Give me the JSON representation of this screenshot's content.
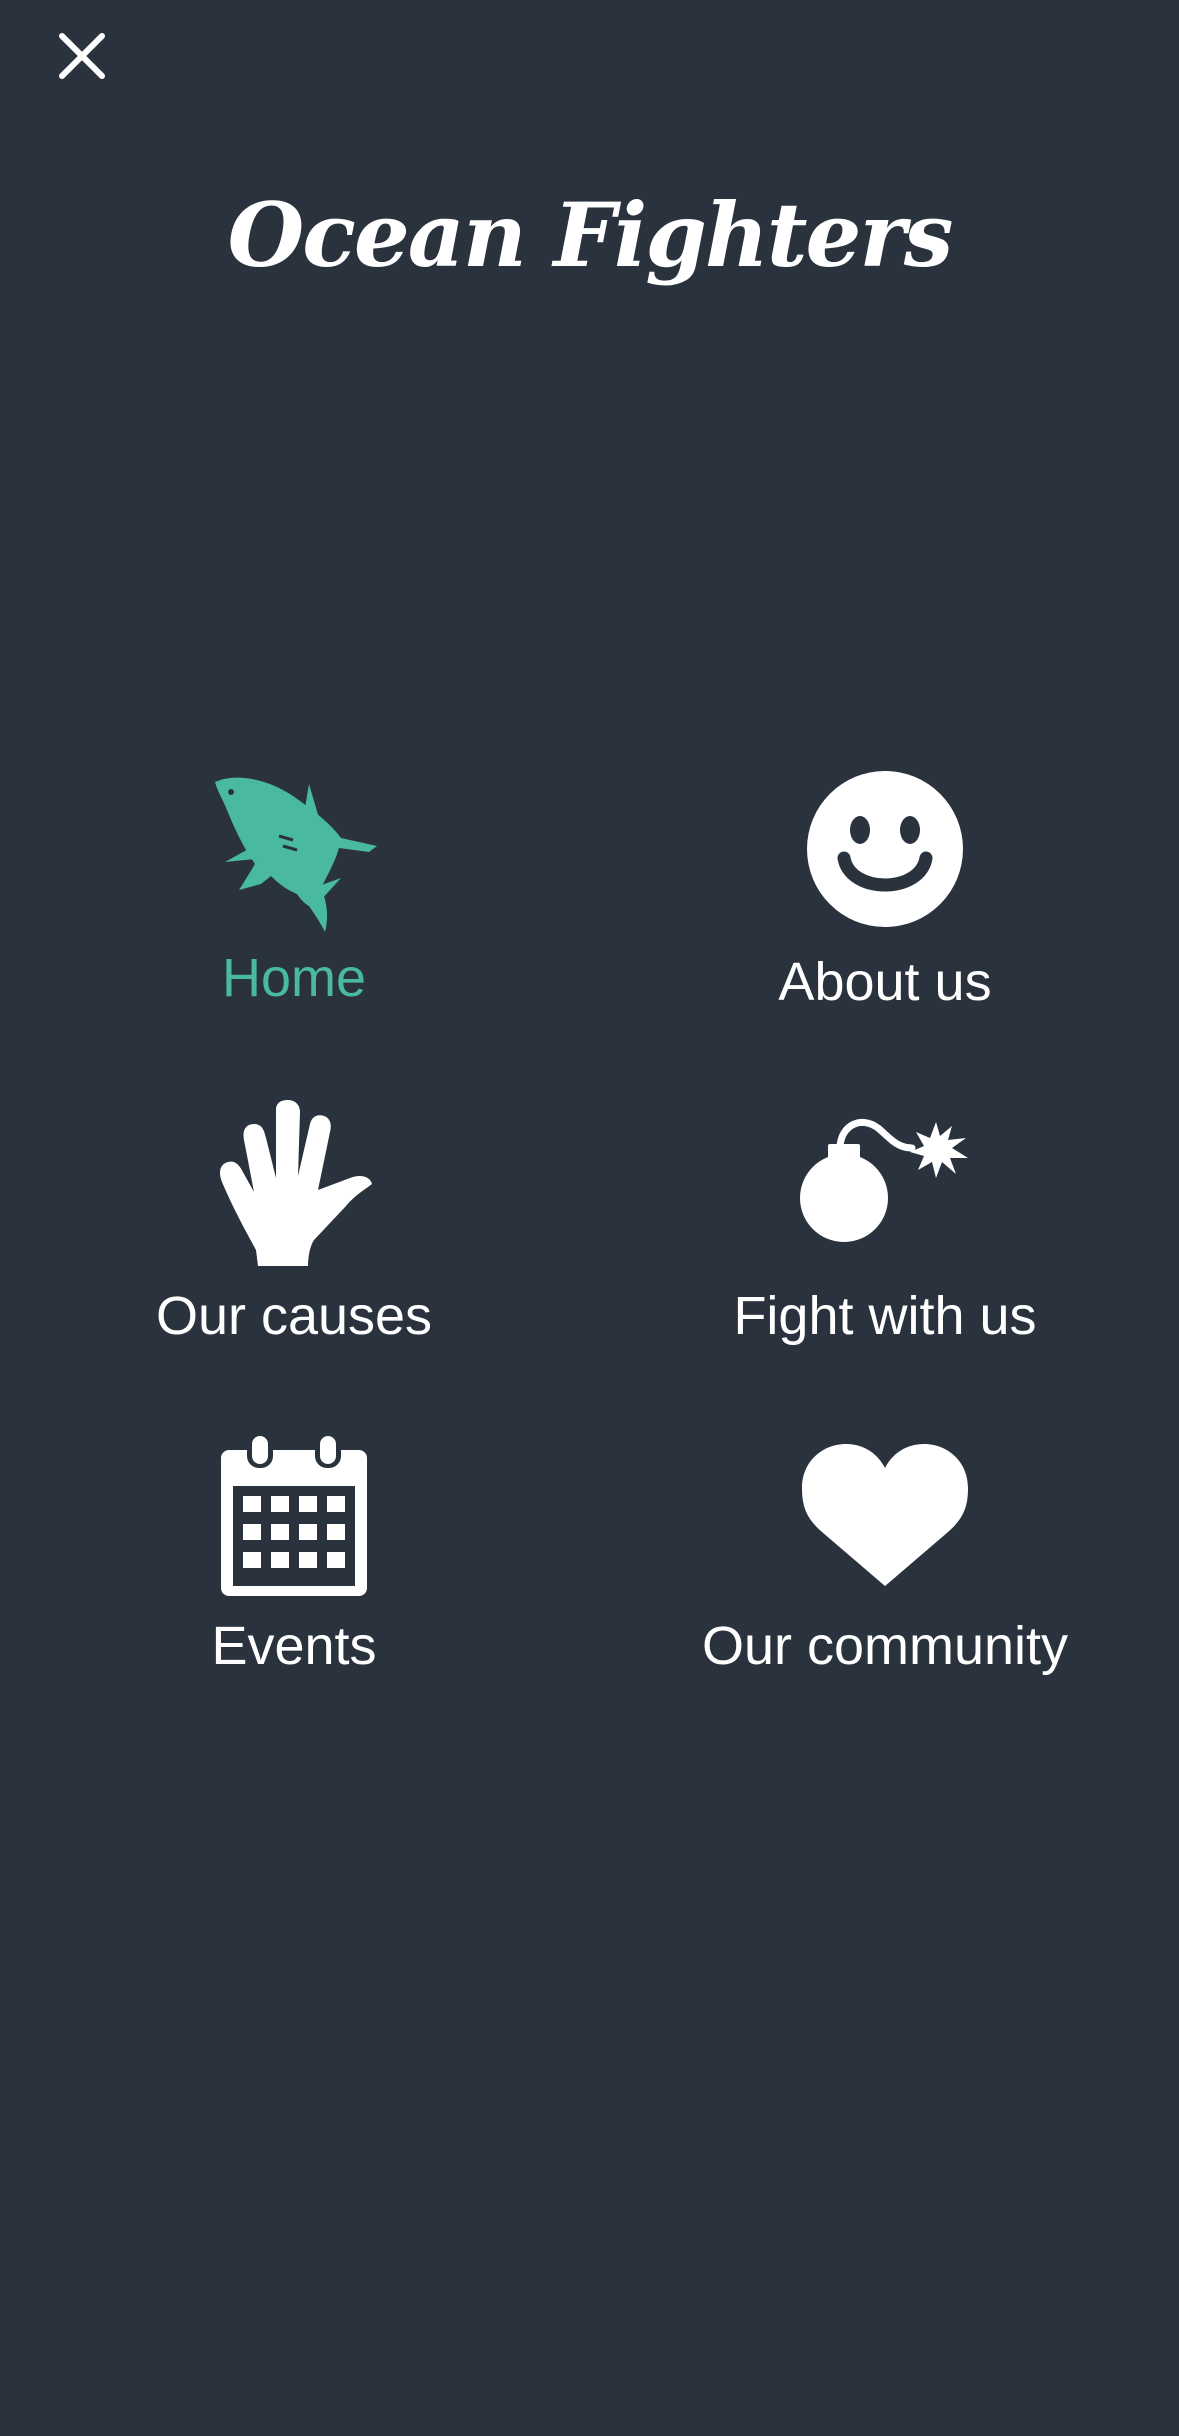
{
  "app": {
    "title": "Ocean Fighters"
  },
  "colors": {
    "background": "#2a333d",
    "accent": "#4ab9a1",
    "text": "#ffffff"
  },
  "header": {
    "close_icon": "close-icon"
  },
  "menu": {
    "items": [
      {
        "label": "Home",
        "icon": "shark-icon",
        "active": true
      },
      {
        "label": "About us",
        "icon": "smiley-icon",
        "active": false
      },
      {
        "label": "Our causes",
        "icon": "hand-icon",
        "active": false
      },
      {
        "label": "Fight with us",
        "icon": "bomb-icon",
        "active": false
      },
      {
        "label": "Events",
        "icon": "calendar-icon",
        "active": false
      },
      {
        "label": "Our community",
        "icon": "heart-icon",
        "active": false
      }
    ]
  }
}
